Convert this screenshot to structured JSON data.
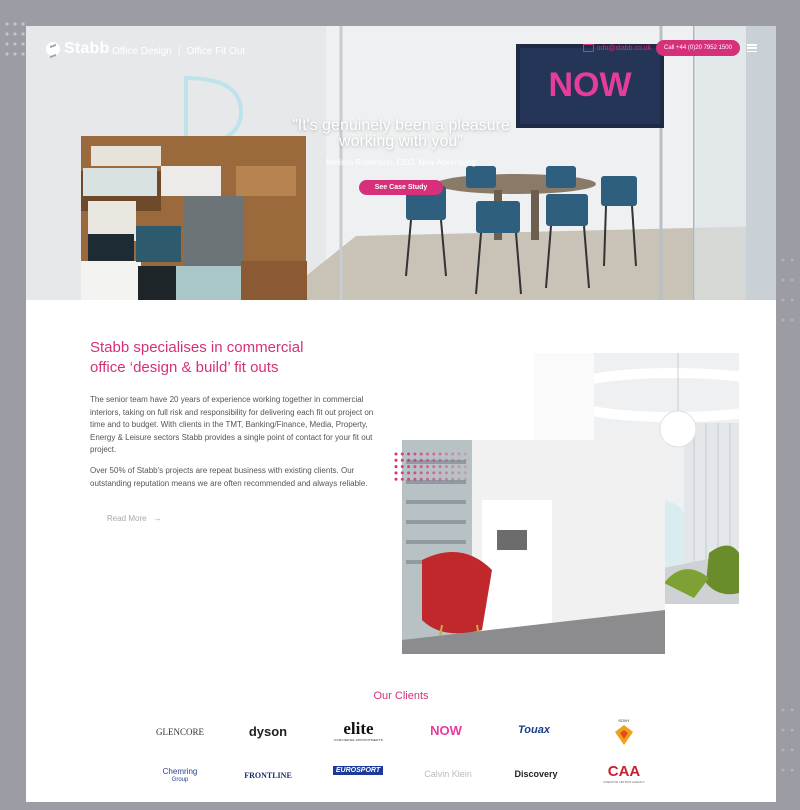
{
  "header": {
    "logo": "Stabb",
    "tagline_1": "Office Design",
    "tagline_separator": "|",
    "tagline_2": "Office Fit Out",
    "email": "info@stabb.co.uk",
    "phone_button": "Call +44 (0)20 7952 1500"
  },
  "hero": {
    "quote_line1": "\"It's genuinely been a pleasure",
    "quote_line2": "working with you\"",
    "author": "Melissa Robertson, CEO, Now Advertising",
    "cta": "See Case Study",
    "screen_text": "NOW"
  },
  "about": {
    "title_line1": "Stabb specialises in commercial",
    "title_line2": "office ‘design & build’ fit outs",
    "paragraph1": "The senior team have 20 years of experience working together in commercial interiors, taking on full risk and responsibility for delivering each fit out project on time and to budget. With clients in the TMT, Banking/Finance, Media, Property, Energy & Leisure sectors Stabb provides a single point of contact for your fit out project.",
    "paragraph2": "Over 50% of Stabb's projects are repeat business with existing clients. Our outstanding reputation means we are often recommended and always reliable.",
    "read_more": "Read More"
  },
  "clients": {
    "title": "Our Clients",
    "row1": [
      "GLENCORE",
      "dyson",
      "elite",
      "NOW",
      "Touax",
      "SONY"
    ],
    "row2": [
      "Chemring Group",
      "FRONTLINE",
      "EUROSPORT",
      "Calvin Klein",
      "Discovery",
      "CAA"
    ],
    "chemring_line1": "Chemring",
    "chemring_line2": "Group",
    "elite_sub": "CONCIERGE APPOINTMENTS",
    "caa_sub": "CREATIVE ARTISTS AGENCY"
  },
  "colors": {
    "accent": "#d6307a",
    "background": "#9c9ca4"
  },
  "icons": [
    "mail-icon",
    "menu-icon",
    "arrow-right-icon",
    "logo-icon"
  ]
}
